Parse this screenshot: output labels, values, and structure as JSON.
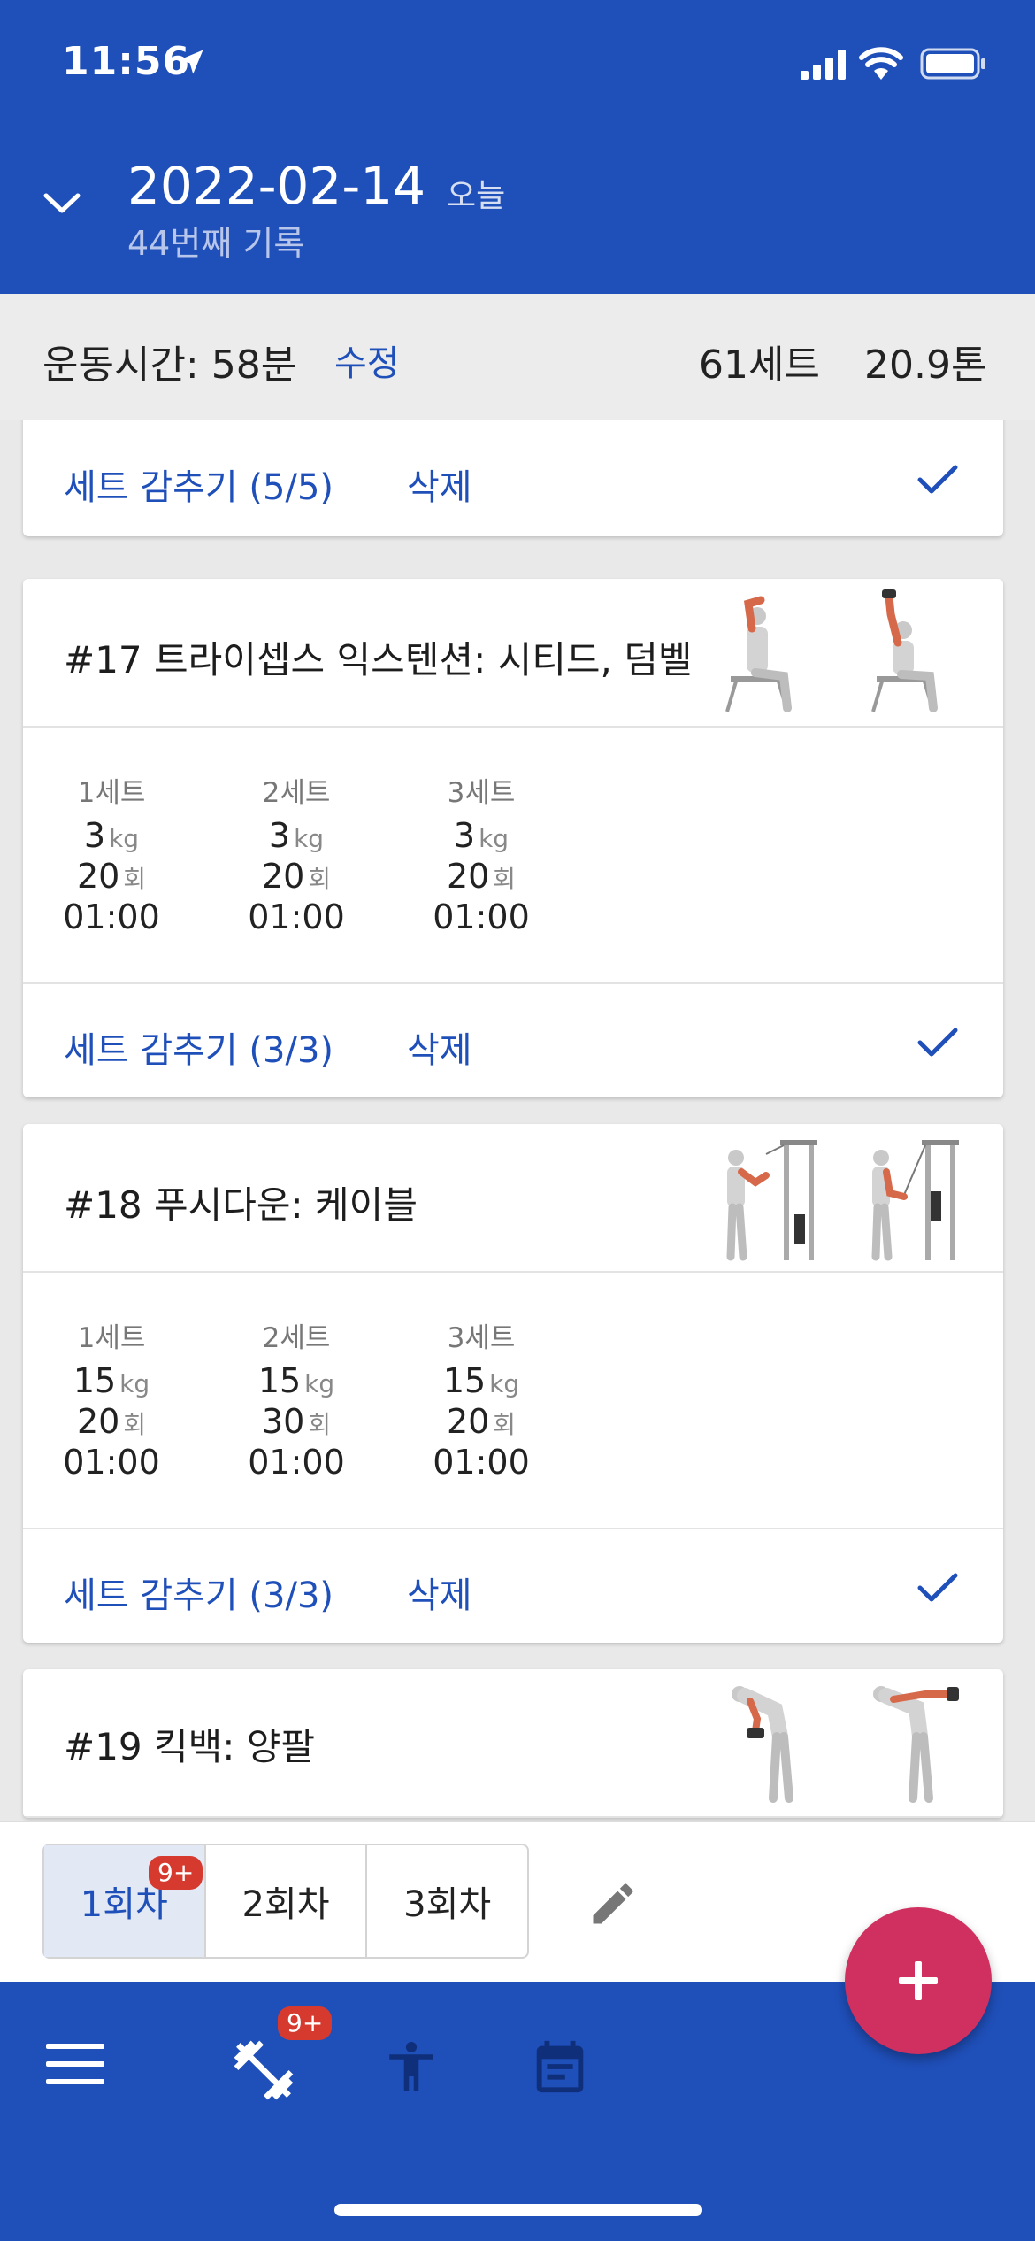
{
  "status": {
    "time": "11:56"
  },
  "header": {
    "date": "2022-02-14",
    "today": "오늘",
    "record": "44번째 기록"
  },
  "summary": {
    "duration": "운동시간: 58분",
    "edit": "수정",
    "sets": "61세트",
    "tons": "20.9톤"
  },
  "prev_card": {
    "hide": "세트 감추기 (5/5)",
    "delete": "삭제"
  },
  "exercises": [
    {
      "title": "#17 트라이셉스 익스텐션: 시티드, 덤벨",
      "sets": [
        {
          "label": "1세트",
          "weight": "3",
          "reps": "20",
          "time": "01:00"
        },
        {
          "label": "2세트",
          "weight": "3",
          "reps": "20",
          "time": "01:00"
        },
        {
          "label": "3세트",
          "weight": "3",
          "reps": "20",
          "time": "01:00"
        }
      ],
      "hide": "세트 감추기 (3/3)",
      "delete": "삭제"
    },
    {
      "title": "#18 푸시다운: 케이블",
      "sets": [
        {
          "label": "1세트",
          "weight": "15",
          "reps": "20",
          "time": "01:00"
        },
        {
          "label": "2세트",
          "weight": "15",
          "reps": "30",
          "time": "01:00"
        },
        {
          "label": "3세트",
          "weight": "15",
          "reps": "20",
          "time": "01:00"
        }
      ],
      "hide": "세트 감추기 (3/3)",
      "delete": "삭제"
    },
    {
      "title": "#19 킥백: 양팔"
    }
  ],
  "units": {
    "weight": "kg",
    "reps": "회"
  },
  "sessions": [
    {
      "label": "1회차"
    },
    {
      "label": "2회차"
    },
    {
      "label": "3회차"
    }
  ],
  "badges": {
    "session": "9+",
    "nav": "9+"
  },
  "colors": {
    "primary": "#1f4fb9",
    "accent": "#d0305f",
    "badge": "#d63a2f"
  },
  "icons": [
    "location-arrow-icon",
    "signal-icon",
    "wifi-icon",
    "battery-icon",
    "chevron-down-icon",
    "check-icon",
    "pencil-icon",
    "menu-icon",
    "dumbbell-icon",
    "person-icon",
    "calendar-icon",
    "plus-icon"
  ]
}
